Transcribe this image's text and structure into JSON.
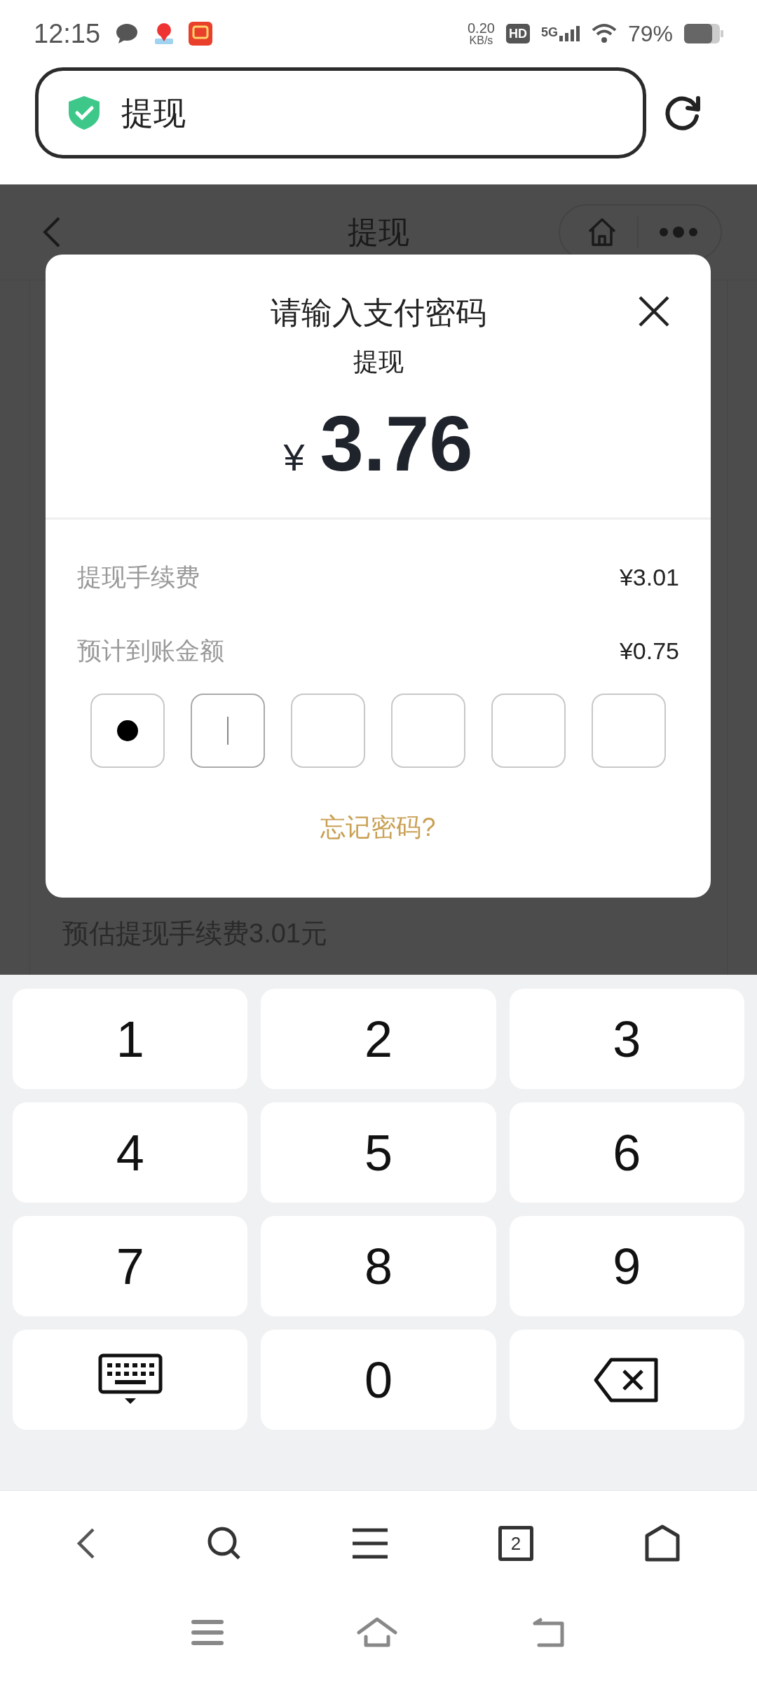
{
  "status_bar": {
    "time": "12:15",
    "speed_value": "0.20",
    "speed_unit": "KB/s",
    "hd": "HD",
    "network": "5G",
    "battery": "79%"
  },
  "address_bar": {
    "title": "提现"
  },
  "page": {
    "title": "提现",
    "hint": "预估提现手续费3.01元"
  },
  "dialog": {
    "title": "请输入支付密码",
    "subtitle": "提现",
    "currency": "¥",
    "amount": "3.76",
    "rows": [
      {
        "label": "提现手续费",
        "value": "¥3.01"
      },
      {
        "label": "预计到账金额",
        "value": "¥0.75"
      }
    ],
    "pin": [
      {
        "filled": true,
        "focused": false
      },
      {
        "filled": false,
        "focused": true
      },
      {
        "filled": false,
        "focused": false
      },
      {
        "filled": false,
        "focused": false
      },
      {
        "filled": false,
        "focused": false
      },
      {
        "filled": false,
        "focused": false
      }
    ],
    "forgot_link": "忘记密码?"
  },
  "keypad": [
    {
      "kind": "digit",
      "label": "1"
    },
    {
      "kind": "digit",
      "label": "2"
    },
    {
      "kind": "digit",
      "label": "3"
    },
    {
      "kind": "digit",
      "label": "4"
    },
    {
      "kind": "digit",
      "label": "5"
    },
    {
      "kind": "digit",
      "label": "6"
    },
    {
      "kind": "digit",
      "label": "7"
    },
    {
      "kind": "digit",
      "label": "8"
    },
    {
      "kind": "digit",
      "label": "9"
    },
    {
      "kind": "keyboard"
    },
    {
      "kind": "digit",
      "label": "0"
    },
    {
      "kind": "backspace"
    }
  ],
  "browser_toolbar": {
    "tab_count": "2"
  }
}
